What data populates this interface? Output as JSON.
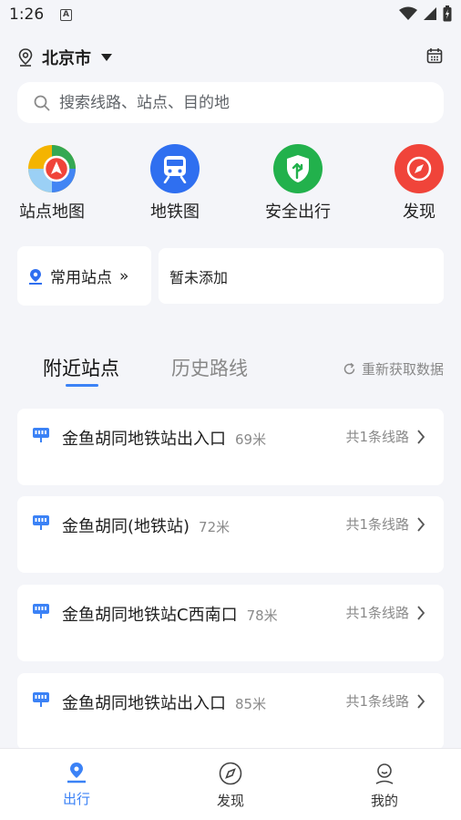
{
  "status": {
    "time": "1:26"
  },
  "header": {
    "city": "北京市",
    "icons": [
      "location-pin-icon",
      "caret-down-icon",
      "calendar-icon"
    ]
  },
  "search": {
    "placeholder": "搜索线路、站点、目的地"
  },
  "quick_actions": [
    {
      "label": "站点地图",
      "icon": "station-map-icon"
    },
    {
      "label": "地铁图",
      "icon": "subway-icon"
    },
    {
      "label": "安全出行",
      "icon": "safety-shield-icon"
    },
    {
      "label": "发现",
      "icon": "compass-icon"
    }
  ],
  "favorites": {
    "title": "常用站点",
    "arrow": "»",
    "empty": "暂未添加"
  },
  "tabs": {
    "active": "附近站点",
    "inactive": "历史路线",
    "refresh": "重新获取数据"
  },
  "stations": [
    {
      "name": "金鱼胡同地铁站出入口",
      "distance": "69米",
      "lines": "共1条线路"
    },
    {
      "name": "金鱼胡同(地铁站)",
      "distance": "72米",
      "lines": "共1条线路"
    },
    {
      "name": "金鱼胡同地铁站C西南口",
      "distance": "78米",
      "lines": "共1条线路"
    },
    {
      "name": "金鱼胡同地铁站出入口",
      "distance": "85米",
      "lines": "共1条线路"
    }
  ],
  "bottom_nav": [
    {
      "label": "出行",
      "active": true
    },
    {
      "label": "发现",
      "active": false
    },
    {
      "label": "我的",
      "active": false
    }
  ],
  "colors": {
    "accent": "#3b82f6",
    "background": "#f4f5f9",
    "subway_blue": "#2f6ff0",
    "safety_green": "#22b14c",
    "discover_red": "#f0443a"
  }
}
